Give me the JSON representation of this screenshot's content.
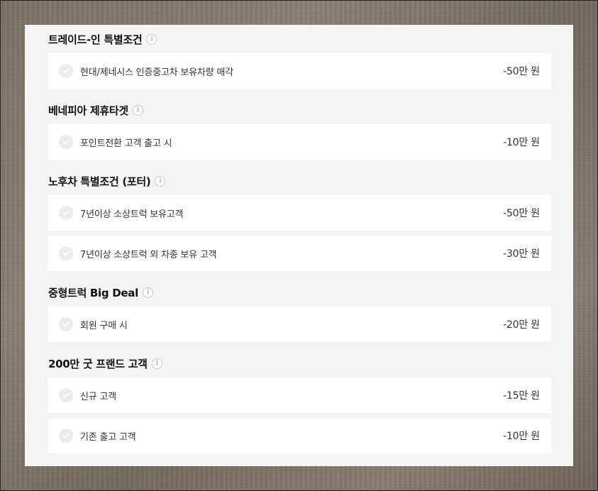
{
  "info_glyph": "i",
  "sections": [
    {
      "title": "트레이드-인 특별조건",
      "items": [
        {
          "label": "현대/제네시스 인증중고차 보유차량 매각",
          "amount": "-50만 원"
        }
      ]
    },
    {
      "title": "베네피아 제휴타겟",
      "items": [
        {
          "label": "포인트전환 고객 출고 시",
          "amount": "-10만 원"
        }
      ]
    },
    {
      "title": "노후차 특별조건 (포터)",
      "items": [
        {
          "label": "7년이상 소상트럭 보유고객",
          "amount": "-50만 원"
        },
        {
          "label": "7년이상 소상트럭 외 차종 보유 고객",
          "amount": "-30만 원"
        }
      ]
    },
    {
      "title": "중형트럭 Big Deal",
      "items": [
        {
          "label": "회원 구매 시",
          "amount": "-20만 원"
        }
      ]
    },
    {
      "title": "200만 굿 프랜드 고객",
      "items": [
        {
          "label": "신규 고객",
          "amount": "-15만 원"
        },
        {
          "label": "기존 출고 고객",
          "amount": "-10만 원"
        }
      ]
    }
  ]
}
